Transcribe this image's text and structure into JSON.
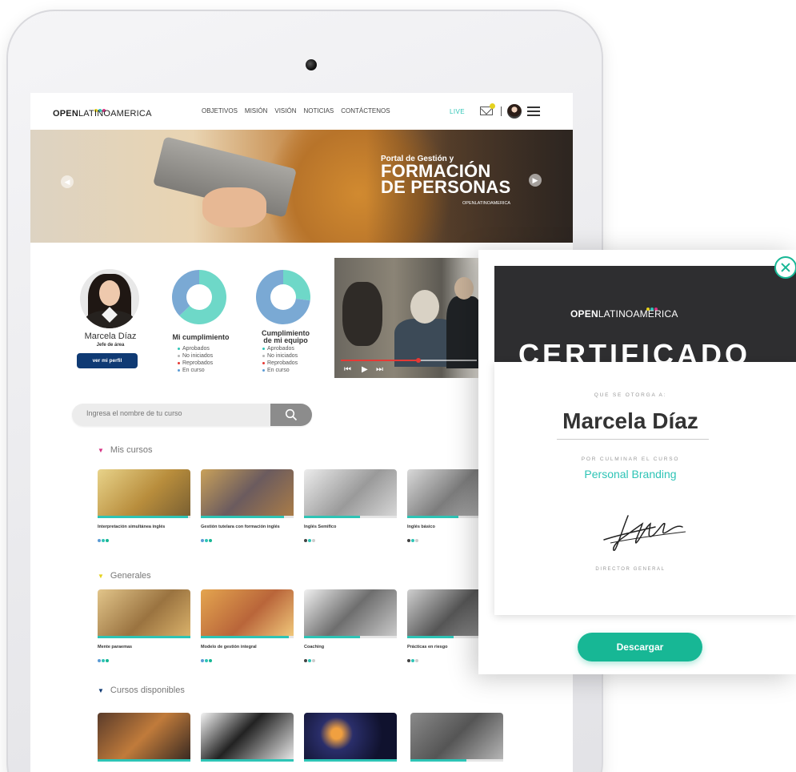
{
  "header": {
    "logo_bold": "OPEN",
    "logo_light": "LATINOAMERICA",
    "nav": [
      "OBJETIVOS",
      "MISIÓN",
      "VISIÓN",
      "NOTICIAS",
      "CONTÁCTENOS"
    ],
    "live": "LIVE"
  },
  "brand_colors": {
    "yellow": "#e5d21e",
    "cyan": "#2ec4b6",
    "magenta": "#d63384",
    "navy": "#0f3a74",
    "green": "#17b795"
  },
  "hero": {
    "subtitle": "Portal de Gestión y",
    "title_line1": "FORMACIÓN",
    "title_line2": "DE PERSONAS",
    "logo": "OPENLATINOAMERICA"
  },
  "profile": {
    "name": "Marcela Díaz",
    "role": "Jefe de área",
    "button": "ver mi perfil"
  },
  "metrics": [
    {
      "title": "Mi cumplimiento",
      "slices": [
        {
          "label": "Aprobados",
          "value": 63,
          "color": "#6ed8c8"
        },
        {
          "label": "En curso",
          "value": 37,
          "color": "#7aa9d4"
        }
      ]
    },
    {
      "title_line1": "Cumplimiento",
      "title_line2": "de mi equipo",
      "slices": [
        {
          "label": "Aprobados",
          "value": 27,
          "color": "#6ed8c8"
        },
        {
          "label": "En curso",
          "value": 73,
          "color": "#7aa9d4"
        }
      ]
    }
  ],
  "legend": [
    {
      "label": "Aprobados",
      "color": "#2ec4b6"
    },
    {
      "label": "No iniciados",
      "color": "#b5b5b5"
    },
    {
      "label": "Reprobados",
      "color": "#e53935"
    },
    {
      "label": "En curso",
      "color": "#5b9bd5"
    }
  ],
  "video": {
    "progress": 0.57
  },
  "search": {
    "placeholder": "Ingresa el nombre de tu curso"
  },
  "sections": [
    {
      "title": "Mis cursos",
      "chevron_color": "#d63384",
      "courses": [
        {
          "title": "Interpretación simultánea inglés",
          "progress": 0.97
        },
        {
          "title": "Gestión tutelara con formación inglés",
          "progress": 0.9
        },
        {
          "title": "Inglés Semifico",
          "progress": 0.6
        },
        {
          "title": "Inglés básico",
          "progress": 0.55
        }
      ]
    },
    {
      "title": "Generales",
      "chevron_color": "#e5d21e",
      "courses": [
        {
          "title": "Mente paraemas",
          "progress": 1.0
        },
        {
          "title": "Modelo de gestión integral",
          "progress": 0.95
        },
        {
          "title": "Coaching",
          "progress": 0.6
        },
        {
          "title": "Prácticas en riesgo",
          "progress": 0.5
        }
      ]
    },
    {
      "title": "Cursos disponibles",
      "chevron_color": "#0f3a74",
      "courses": [
        {
          "title": "",
          "progress": 1.0
        },
        {
          "title": "",
          "progress": 1.0
        },
        {
          "title": "",
          "progress": 1.0
        },
        {
          "title": "",
          "progress": 0.6
        }
      ]
    }
  ],
  "certificate": {
    "logo_bold": "OPEN",
    "logo_light": "LATINOAMERICA",
    "heading": "CERTIFICADO",
    "given_to": "QUE SE OTORGA A:",
    "name": "Marcela Díaz",
    "for_course": "POR CULMINAR EL CURSO",
    "course": "Personal Branding",
    "director": "DIRECTOR GENERAL",
    "button": "Descargar"
  }
}
